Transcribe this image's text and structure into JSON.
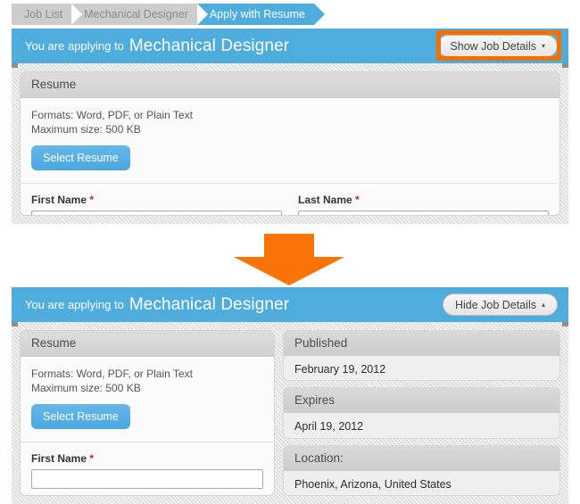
{
  "colors": {
    "accent_blue": "#4fadde",
    "button_blue": "#59b0e4",
    "highlight_orange": "#f37000",
    "arrow_orange": "#f97306",
    "breadcrumb_gray": "#cdcdcd",
    "required_red": "#c0252b"
  },
  "breadcrumb": {
    "items": [
      {
        "label": "Job List",
        "current": false
      },
      {
        "label": "Mechanical Designer",
        "current": false
      },
      {
        "label": "Apply with Resume",
        "current": true
      }
    ]
  },
  "panels": [
    {
      "state": "collapsed",
      "bluebar": {
        "prefix": "You are applying to",
        "job_title": "Mechanical Designer",
        "toggle_label": "Show Job Details",
        "toggle_caret": "▾",
        "toggle_caret_name": "chevron-down-icon",
        "highlighted": true
      },
      "resume_card": {
        "header": "Resume",
        "formats_line": "Formats: Word, PDF, or Plain Text",
        "maxsize_line": "Maximum size: 500 KB",
        "select_button": "Select Resume"
      },
      "fields": [
        {
          "label": "First Name",
          "required_marker": "*",
          "value": "",
          "placeholder": ""
        },
        {
          "label": "Last Name",
          "required_marker": "*",
          "value": "",
          "placeholder": ""
        }
      ]
    },
    {
      "state": "expanded",
      "bluebar": {
        "prefix": "You are applying to",
        "job_title": "Mechanical Designer",
        "toggle_label": "Hide Job Details",
        "toggle_caret": "▴",
        "toggle_caret_name": "chevron-up-icon",
        "highlighted": false
      },
      "resume_card": {
        "header": "Resume",
        "formats_line": "Formats: Word, PDF, or Plain Text",
        "maxsize_line": "Maximum size: 500 KB",
        "select_button": "Select Resume"
      },
      "fields": [
        {
          "label": "First Name",
          "required_marker": "*",
          "value": "",
          "placeholder": ""
        }
      ],
      "job_details": [
        {
          "header": "Published",
          "value": "February 19, 2012"
        },
        {
          "header": "Expires",
          "value": "April 19, 2012"
        },
        {
          "header": "Location:",
          "value": "Phoenix, Arizona, United States"
        }
      ]
    }
  ],
  "annotation": {
    "arrow_icon_name": "orange-down-arrow-icon",
    "arrow_direction": "down"
  }
}
